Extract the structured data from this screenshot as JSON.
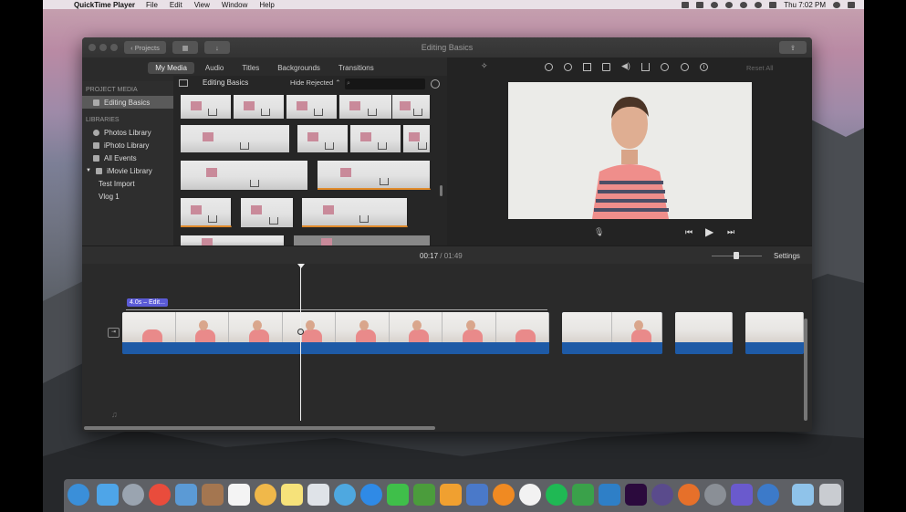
{
  "menubar": {
    "app_name": "QuickTime Player",
    "items": [
      "File",
      "Edit",
      "View",
      "Window",
      "Help"
    ],
    "clock": "Thu 7:02 PM"
  },
  "window": {
    "title": "Editing Basics",
    "projects_label": "Projects"
  },
  "media_tabs": [
    "My Media",
    "Audio",
    "Titles",
    "Backgrounds",
    "Transitions"
  ],
  "sidebar": {
    "project_media_header": "PROJECT MEDIA",
    "project_item": "Editing Basics",
    "libraries_header": "LIBRARIES",
    "libraries": [
      "Photos Library",
      "iPhoto Library",
      "All Events",
      "iMovie Library"
    ],
    "imovie_children": [
      "Test Import",
      "Vlog 1"
    ]
  },
  "browser": {
    "title": "Editing Basics",
    "filter": "Hide Rejected"
  },
  "viewer": {
    "reset_all": "Reset All"
  },
  "timeline": {
    "current_time": "00:17",
    "separator": "/",
    "total_time": "01:49",
    "settings_label": "Settings",
    "clip_label": "4.0s – Edit..."
  },
  "colors": {
    "accent_blue": "#1e5aa6",
    "clip_title_purple": "#5b5bd6",
    "window_bg": "#2b2b2b"
  }
}
